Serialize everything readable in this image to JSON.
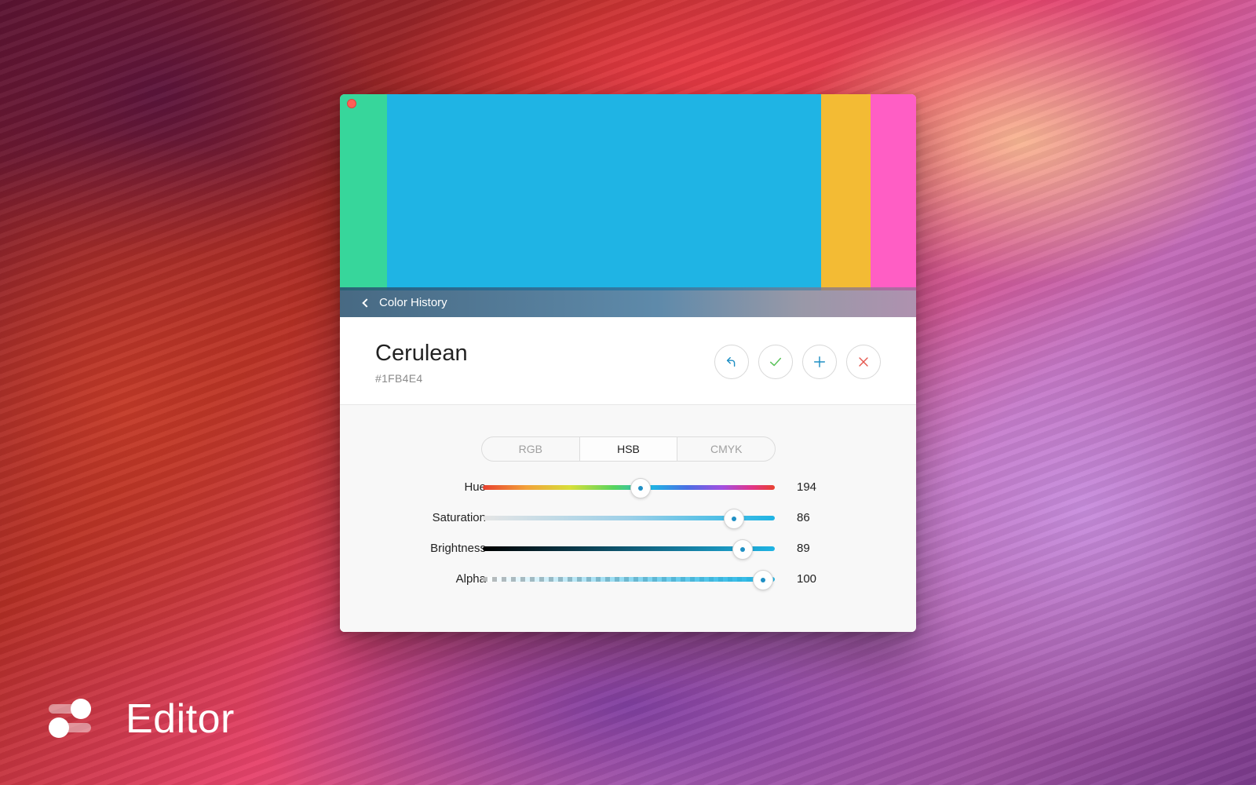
{
  "app": {
    "swatches": [
      {
        "name": "green",
        "color": "#37D69B"
      },
      {
        "name": "cerulean",
        "color": "#1FB4E4"
      },
      {
        "name": "yellow",
        "color": "#F3BB34"
      },
      {
        "name": "pink",
        "color": "#FF5EC4"
      }
    ],
    "history_label": "Color History"
  },
  "color": {
    "name": "Cerulean",
    "hex": "#1FB4E4"
  },
  "actions": [
    "undo-icon",
    "check-icon",
    "plus-icon",
    "close-icon"
  ],
  "modes": {
    "tabs": [
      "RGB",
      "HSB",
      "CMYK"
    ],
    "active": "HSB"
  },
  "sliders": {
    "hue": {
      "label": "Hue",
      "value": "194",
      "fraction": 0.539
    },
    "saturation": {
      "label": "Saturation",
      "value": "86",
      "fraction": 0.86
    },
    "brightness": {
      "label": "Brightness",
      "value": "89",
      "fraction": 0.89
    },
    "alpha": {
      "label": "Alpha",
      "value": "100",
      "fraction": 0.96
    }
  },
  "badge": {
    "title": "Editor"
  },
  "colors": {
    "accent": "#1FB4E4",
    "close_red": "#FF5F57",
    "check_green": "#5CC35C",
    "cancel_red": "#E5584F"
  }
}
